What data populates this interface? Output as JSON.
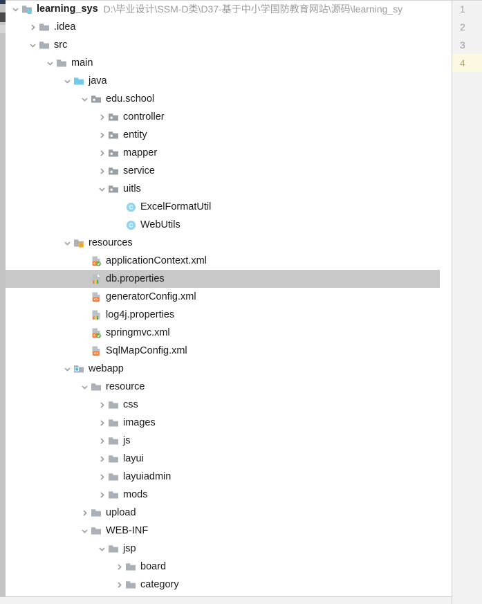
{
  "window": {
    "kind": "ide-project-tree",
    "colors": {
      "selection": "#c8c8c8",
      "folder_gray": "#a9b0b8",
      "source_root_blue": "#6ecbe8",
      "class_icon_blue": "#92d5ec",
      "xml_orange": "#f0803c",
      "gutter_highlight": "#fdf8e2",
      "path_text": "#9b9b9b"
    }
  },
  "project": {
    "name": "learning_sys",
    "path": "D:\\毕业设计\\SSM-D类\\D37-基于中小学国防教育网站\\源码\\learning_sy"
  },
  "tree": {
    "selected_node": "db.properties",
    "nodes": [
      {
        "label": "learning_sys",
        "path": "D:\\毕业设计\\SSM-D类\\D37-基于中小学国防教育网站\\源码\\learning_sy",
        "depth": 0,
        "arrow": "down",
        "icon": "project-root-folder-icon",
        "bold": true,
        "selected": false
      },
      {
        "label": ".idea",
        "depth": 1,
        "arrow": "right",
        "icon": "folder-icon",
        "bold": false,
        "selected": false
      },
      {
        "label": "src",
        "depth": 1,
        "arrow": "down",
        "icon": "folder-icon",
        "bold": false,
        "selected": false
      },
      {
        "label": "main",
        "depth": 2,
        "arrow": "down",
        "icon": "folder-icon",
        "bold": false,
        "selected": false
      },
      {
        "label": "java",
        "depth": 3,
        "arrow": "down",
        "icon": "source-root-folder-icon",
        "bold": false,
        "selected": false
      },
      {
        "label": "edu.school",
        "depth": 4,
        "arrow": "down",
        "icon": "package-icon",
        "bold": false,
        "selected": false
      },
      {
        "label": "controller",
        "depth": 5,
        "arrow": "right",
        "icon": "package-icon",
        "bold": false,
        "selected": false
      },
      {
        "label": "entity",
        "depth": 5,
        "arrow": "right",
        "icon": "package-icon",
        "bold": false,
        "selected": false
      },
      {
        "label": "mapper",
        "depth": 5,
        "arrow": "right",
        "icon": "package-icon",
        "bold": false,
        "selected": false
      },
      {
        "label": "service",
        "depth": 5,
        "arrow": "right",
        "icon": "package-icon",
        "bold": false,
        "selected": false
      },
      {
        "label": "uitls",
        "depth": 5,
        "arrow": "down",
        "icon": "package-icon",
        "bold": false,
        "selected": false
      },
      {
        "label": "ExcelFormatUtil",
        "depth": 6,
        "arrow": "none",
        "icon": "java-class-icon",
        "bold": false,
        "selected": false
      },
      {
        "label": "WebUtils",
        "depth": 6,
        "arrow": "none",
        "icon": "java-class-icon",
        "bold": false,
        "selected": false
      },
      {
        "label": "resources",
        "depth": 3,
        "arrow": "down",
        "icon": "resource-root-folder-icon",
        "bold": false,
        "selected": false
      },
      {
        "label": "applicationContext.xml",
        "depth": 4,
        "arrow": "none",
        "icon": "spring-xml-file-icon",
        "bold": false,
        "selected": false
      },
      {
        "label": "db.properties",
        "depth": 4,
        "arrow": "none",
        "icon": "properties-file-icon",
        "bold": false,
        "selected": true
      },
      {
        "label": "generatorConfig.xml",
        "depth": 4,
        "arrow": "none",
        "icon": "xml-file-icon",
        "bold": false,
        "selected": false
      },
      {
        "label": "log4j.properties",
        "depth": 4,
        "arrow": "none",
        "icon": "properties-file-icon",
        "bold": false,
        "selected": false
      },
      {
        "label": "springmvc.xml",
        "depth": 4,
        "arrow": "none",
        "icon": "spring-xml-file-icon",
        "bold": false,
        "selected": false
      },
      {
        "label": "SqlMapConfig.xml",
        "depth": 4,
        "arrow": "none",
        "icon": "xml-file-icon",
        "bold": false,
        "selected": false
      },
      {
        "label": "webapp",
        "depth": 3,
        "arrow": "down",
        "icon": "web-root-folder-icon",
        "bold": false,
        "selected": false
      },
      {
        "label": "resource",
        "depth": 4,
        "arrow": "down",
        "icon": "folder-icon",
        "bold": false,
        "selected": false
      },
      {
        "label": "css",
        "depth": 5,
        "arrow": "right",
        "icon": "folder-icon",
        "bold": false,
        "selected": false
      },
      {
        "label": "images",
        "depth": 5,
        "arrow": "right",
        "icon": "folder-icon",
        "bold": false,
        "selected": false
      },
      {
        "label": "js",
        "depth": 5,
        "arrow": "right",
        "icon": "folder-icon",
        "bold": false,
        "selected": false
      },
      {
        "label": "layui",
        "depth": 5,
        "arrow": "right",
        "icon": "folder-icon",
        "bold": false,
        "selected": false
      },
      {
        "label": "layuiadmin",
        "depth": 5,
        "arrow": "right",
        "icon": "folder-icon",
        "bold": false,
        "selected": false
      },
      {
        "label": "mods",
        "depth": 5,
        "arrow": "right",
        "icon": "folder-icon",
        "bold": false,
        "selected": false
      },
      {
        "label": "upload",
        "depth": 4,
        "arrow": "right",
        "icon": "folder-icon",
        "bold": false,
        "selected": false
      },
      {
        "label": "WEB-INF",
        "depth": 4,
        "arrow": "down",
        "icon": "folder-icon",
        "bold": false,
        "selected": false
      },
      {
        "label": "jsp",
        "depth": 5,
        "arrow": "down",
        "icon": "folder-icon",
        "bold": false,
        "selected": false
      },
      {
        "label": "board",
        "depth": 6,
        "arrow": "right",
        "icon": "folder-icon",
        "bold": false,
        "selected": false
      },
      {
        "label": "category",
        "depth": 6,
        "arrow": "right",
        "icon": "folder-icon",
        "bold": false,
        "selected": false
      }
    ]
  },
  "gutter": {
    "lines": [
      {
        "number": "1",
        "highlighted": false
      },
      {
        "number": "2",
        "highlighted": false
      },
      {
        "number": "3",
        "highlighted": false
      },
      {
        "number": "4",
        "highlighted": true
      }
    ]
  }
}
